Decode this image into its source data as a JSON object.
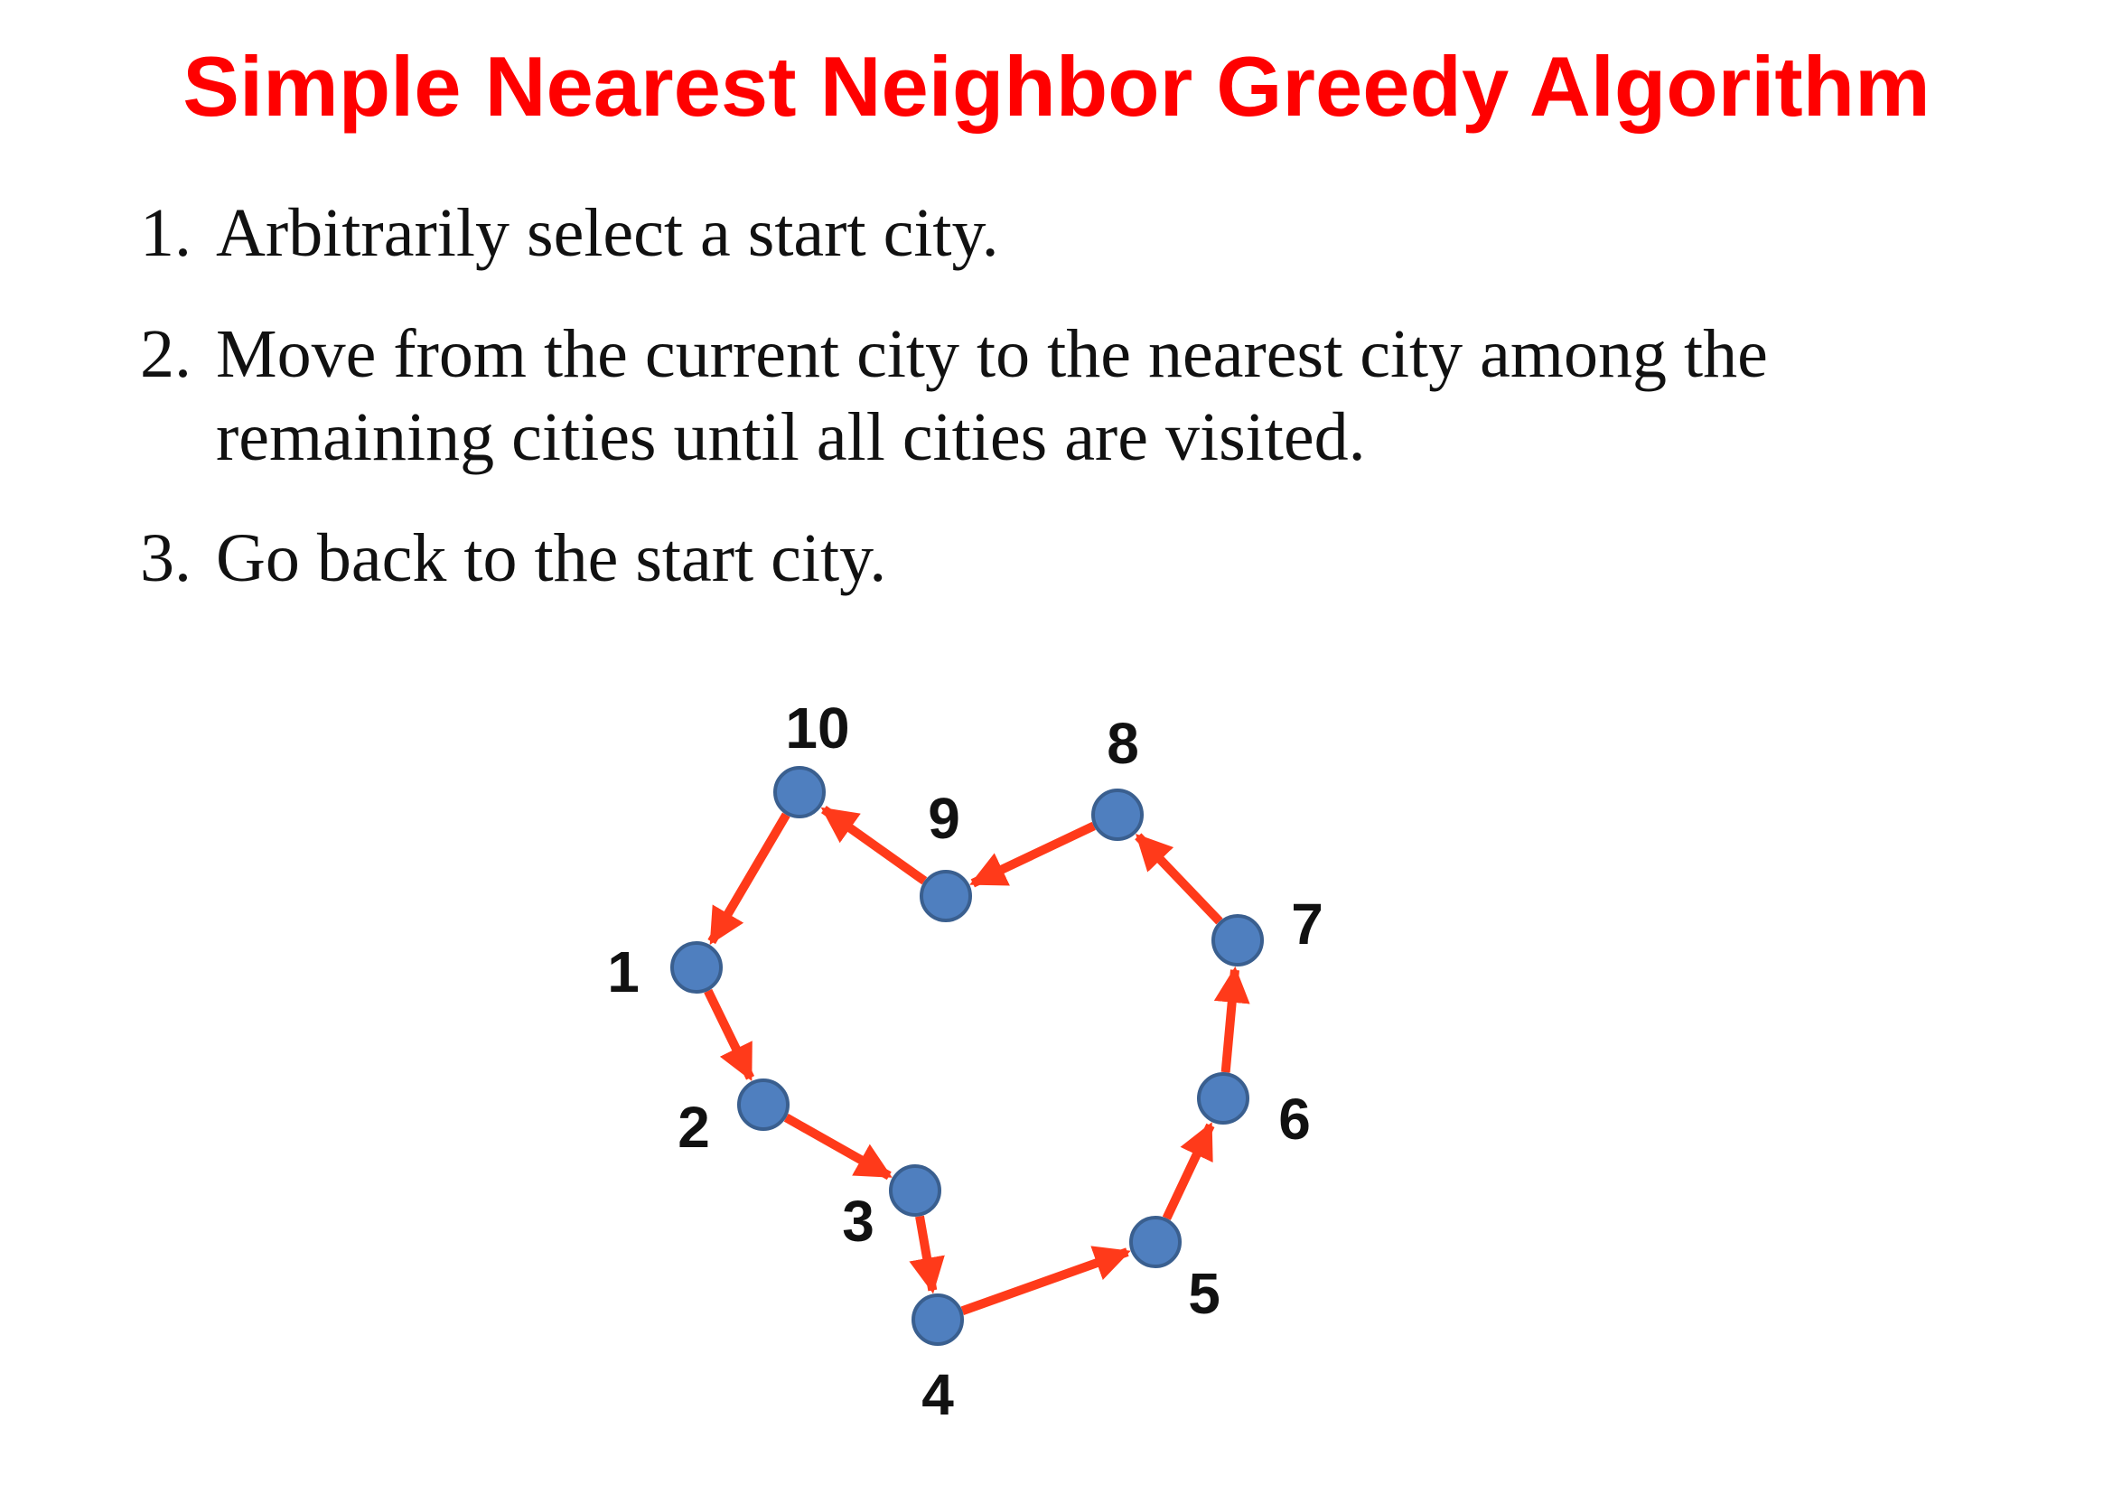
{
  "title": "Simple Nearest Neighbor Greedy Algorithm",
  "steps": [
    {
      "number": "1.",
      "text": "Arbitrarily select a start city."
    },
    {
      "number": "2.",
      "text": "Move from the current city to the nearest city among the remaining cities until all cities are visited."
    },
    {
      "number": "3.",
      "text": "Go back to the start city."
    }
  ],
  "diagram": {
    "nodes": [
      {
        "id": "1",
        "label": "1"
      },
      {
        "id": "2",
        "label": "2"
      },
      {
        "id": "3",
        "label": "3"
      },
      {
        "id": "4",
        "label": "4"
      },
      {
        "id": "5",
        "label": "5"
      },
      {
        "id": "6",
        "label": "6"
      },
      {
        "id": "7",
        "label": "7"
      },
      {
        "id": "8",
        "label": "8"
      },
      {
        "id": "9",
        "label": "9"
      },
      {
        "id": "10",
        "label": "10"
      }
    ],
    "edges": [
      {
        "from": "1",
        "to": "2"
      },
      {
        "from": "2",
        "to": "3"
      },
      {
        "from": "3",
        "to": "4"
      },
      {
        "from": "4",
        "to": "5"
      },
      {
        "from": "5",
        "to": "6"
      },
      {
        "from": "6",
        "to": "7"
      },
      {
        "from": "7",
        "to": "8"
      },
      {
        "from": "8",
        "to": "9"
      },
      {
        "from": "9",
        "to": "10"
      },
      {
        "from": "10",
        "to": "1"
      }
    ],
    "colors": {
      "node_fill": "#4f7fbf",
      "edge": "#ff3a1a",
      "title": "#ff0000"
    }
  }
}
